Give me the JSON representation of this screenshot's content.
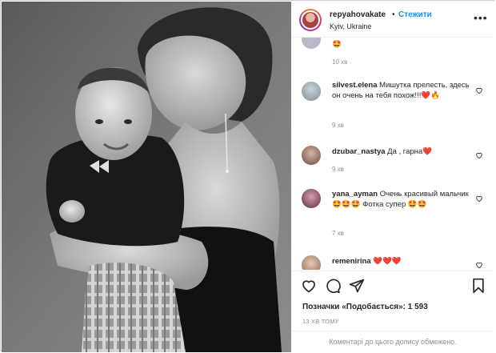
{
  "post": {
    "username": "repyahovakate",
    "separator": "•",
    "follow_label": "Стежити",
    "location": "Kyiv, Ukraine",
    "more_label": "•••"
  },
  "comments": [
    {
      "username": "",
      "text": "🤩",
      "time": "10 хв"
    },
    {
      "username": "silvest.elena",
      "text": "Мишутка прелесть, здесь он очень на тебя похож!!!❤️🔥",
      "time": "9 хв"
    },
    {
      "username": "dzubar_nastya",
      "text": "Да , гарна❤️",
      "time": "9 хв"
    },
    {
      "username": "yana_ayman",
      "text": "Очень красивый мальчик 🤩🤩🤩 Фотка супер 🤩🤩",
      "time": "7 хв"
    },
    {
      "username": "remenirina",
      "text": "❤️❤️❤️",
      "time": ""
    }
  ],
  "likes_text": "Позначки «Подобається»: 1 593",
  "posted_ago": "13 ХВ ТОМУ",
  "comments_closed": "Коментарі до цього допису обмежено.",
  "icons": [
    "heart-icon",
    "comment-icon",
    "share-icon",
    "bookmark-icon",
    "more-icon",
    "like-comment-icon"
  ],
  "colors": {
    "follow": "#0095f6",
    "muted": "#8e8e8e",
    "text": "#262626",
    "heart": "#e0245e"
  }
}
